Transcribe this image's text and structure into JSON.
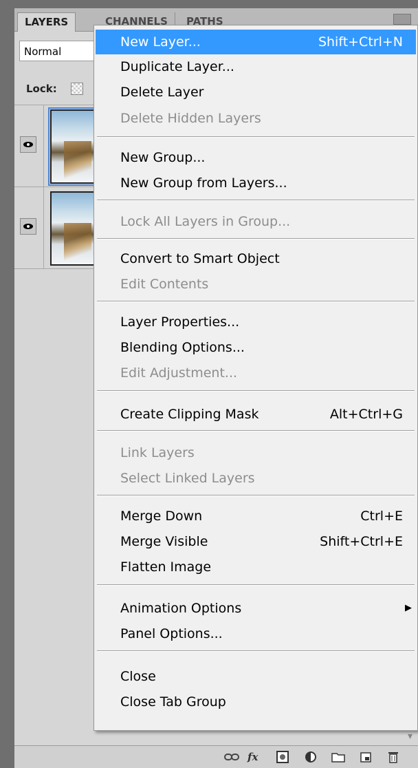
{
  "panel": {
    "tabs": [
      "LAYERS",
      "CHANNELS",
      "PATHS"
    ],
    "blend_mode": "Normal",
    "lock_label": "Lock:",
    "layers": [
      {
        "visible": true,
        "selected": true
      },
      {
        "visible": true,
        "selected": false
      }
    ],
    "bottom_icons": [
      "link-layers-icon",
      "fx-icon",
      "layer-mask-icon",
      "adjustment-layer-icon",
      "new-group-icon",
      "new-layer-icon",
      "trash-icon"
    ],
    "fx_label": "fx"
  },
  "menu": {
    "items": [
      {
        "label": "New Layer...",
        "shortcut": "Shift+Ctrl+N",
        "disabled": false,
        "highlighted": true
      },
      {
        "label": "Duplicate Layer...",
        "shortcut": "",
        "disabled": false
      },
      {
        "label": "Delete Layer",
        "shortcut": "",
        "disabled": false
      },
      {
        "label": "Delete Hidden Layers",
        "shortcut": "",
        "disabled": true
      },
      {
        "label": "New Group...",
        "shortcut": "",
        "disabled": false
      },
      {
        "label": "New Group from Layers...",
        "shortcut": "",
        "disabled": false
      },
      {
        "label": "Lock All Layers in Group...",
        "shortcut": "",
        "disabled": true
      },
      {
        "label": "Convert to Smart Object",
        "shortcut": "",
        "disabled": false
      },
      {
        "label": "Edit Contents",
        "shortcut": "",
        "disabled": true
      },
      {
        "label": "Layer Properties...",
        "shortcut": "",
        "disabled": false
      },
      {
        "label": "Blending Options...",
        "shortcut": "",
        "disabled": false
      },
      {
        "label": "Edit Adjustment...",
        "shortcut": "",
        "disabled": true
      },
      {
        "label": "Create Clipping Mask",
        "shortcut": "Alt+Ctrl+G",
        "disabled": false
      },
      {
        "label": "Link Layers",
        "shortcut": "",
        "disabled": true
      },
      {
        "label": "Select Linked Layers",
        "shortcut": "",
        "disabled": true
      },
      {
        "label": "Merge Down",
        "shortcut": "Ctrl+E",
        "disabled": false
      },
      {
        "label": "Merge Visible",
        "shortcut": "Shift+Ctrl+E",
        "disabled": false
      },
      {
        "label": "Flatten Image",
        "shortcut": "",
        "disabled": false
      },
      {
        "label": "Animation Options",
        "shortcut": "",
        "disabled": false,
        "submenu": true
      },
      {
        "label": "Panel Options...",
        "shortcut": "",
        "disabled": false
      },
      {
        "label": "Close",
        "shortcut": "",
        "disabled": false
      },
      {
        "label": "Close Tab Group",
        "shortcut": "",
        "disabled": false
      }
    ]
  },
  "colors": {
    "highlight": "#3399ff",
    "disabled_text": "#8d8d8d",
    "menu_bg": "#f0f0f0"
  }
}
